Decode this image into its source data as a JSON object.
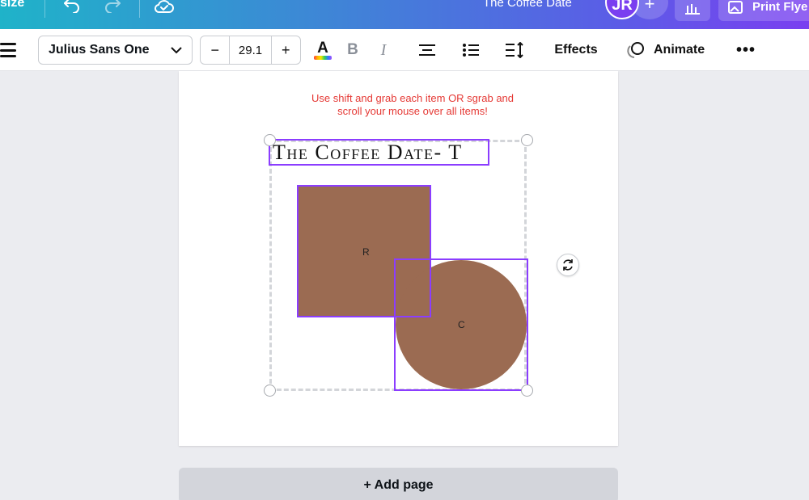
{
  "topbar": {
    "resize_label": "size",
    "document_title": "The Coffee Date",
    "avatar_initials": "JR",
    "add_collaborator": "+",
    "print_label": "Print Flye",
    "gradient_colors": [
      "#1fb3c9",
      "#3e86d6",
      "#5a5ee6",
      "#7a3ff0"
    ]
  },
  "toolbar": {
    "font_family": "Julius Sans One",
    "decrease": "−",
    "font_size": "29.1",
    "increase": "+",
    "text_color_letter": "A",
    "bold": "B",
    "italic": "I",
    "effects": "Effects",
    "animate": "Animate",
    "more": "•••"
  },
  "canvas": {
    "instructions_line1": "Use shift and grab each item OR sgrab and",
    "instructions_line2": "scroll your mouse over all items!",
    "title_text": "The Coffee Date- T",
    "rect_label": "R",
    "circle_label": "C",
    "shape_color": "#9b6b52",
    "selection_color": "#8b3dff",
    "instructions_color": "#e53935"
  },
  "footer": {
    "add_page": "+ Add page"
  }
}
